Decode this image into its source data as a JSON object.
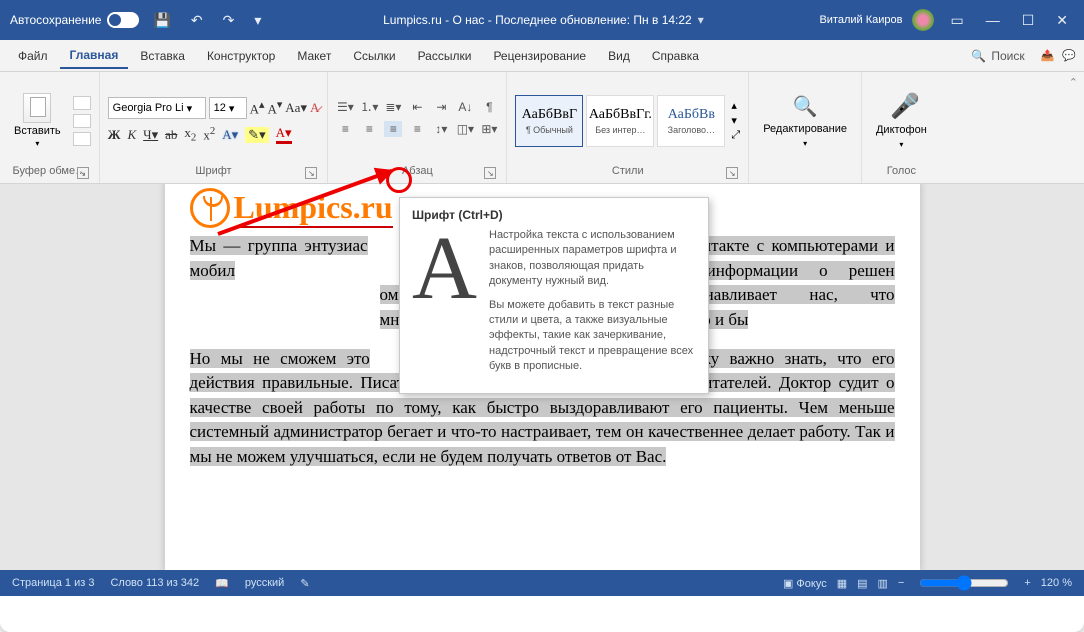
{
  "titlebar": {
    "autosave": "Автосохранение",
    "title": "Lumpics.ru - О нас - Последнее обновление: Пн в 14:22",
    "user": "Виталий Каиров"
  },
  "tabs": {
    "list": [
      "Файл",
      "Главная",
      "Вставка",
      "Конструктор",
      "Макет",
      "Ссылки",
      "Рассылки",
      "Рецензирование",
      "Вид",
      "Справка"
    ],
    "active": 1,
    "search": "Поиск"
  },
  "ribbon": {
    "clipboard": {
      "label": "Буфер обме…",
      "paste": "Вставить"
    },
    "font": {
      "label": "Шрифт",
      "family": "Georgia Pro Li",
      "size": "12",
      "b": "Ж",
      "i": "К",
      "u": "Ч"
    },
    "paragraph": {
      "label": "Абзац"
    },
    "styles": {
      "label": "Стили",
      "items": [
        {
          "preview": "АаБбВвГ",
          "name": "¶ Обычный"
        },
        {
          "preview": "АаБбВвГг.",
          "name": "Без интер…"
        },
        {
          "preview": "АаБбВв",
          "name": "Заголово…"
        }
      ]
    },
    "editing": {
      "label": "Редактирование"
    },
    "voice": {
      "label": "Голос",
      "btn": "Диктофон"
    }
  },
  "tooltip": {
    "title": "Шрифт (Ctrl+D)",
    "p1": "Настройка текста с использованием расширенных параметров шрифта и знаков, позволяющая придать документу нужный вид.",
    "p2": "Вы можете добавить в текст разные стили и цвета, а также визуальные эффекты, такие как зачеркивание, надстрочный текст и превращение всех букв в прописные."
  },
  "doc": {
    "logo": "Lumpics.ru",
    "para1_a": "Мы — группа энтузиас",
    "para1_b": "м в ежедневном контакте с компьютерами и мобил",
    "para1_c": "что в интернете уже полно информации о решен",
    "para1_d": "омпьютерами. Но это не останавливает нас, что",
    "para1_e": "многие проблемы и задачи более качественно и бы",
    "para2_a": "Но мы не сможем это",
    "para2_b": "и. Любому человеку важно знать, что его действия правильные. Писатель судит о своей работе по отзывам читателей. Доктор судит о качестве своей работы по тому, как быстро выздоравливают его пациенты. Чем меньше системный администратор бегает и что-то настраивает, тем он качественнее делает работу. Так и мы не можем улучшаться, если не будем получать ответов от Вас."
  },
  "status": {
    "page": "Страница 1 из 3",
    "words": "Слово 113 из 342",
    "lang": "русский",
    "focus": "Фокус",
    "zoom": "120 %"
  }
}
